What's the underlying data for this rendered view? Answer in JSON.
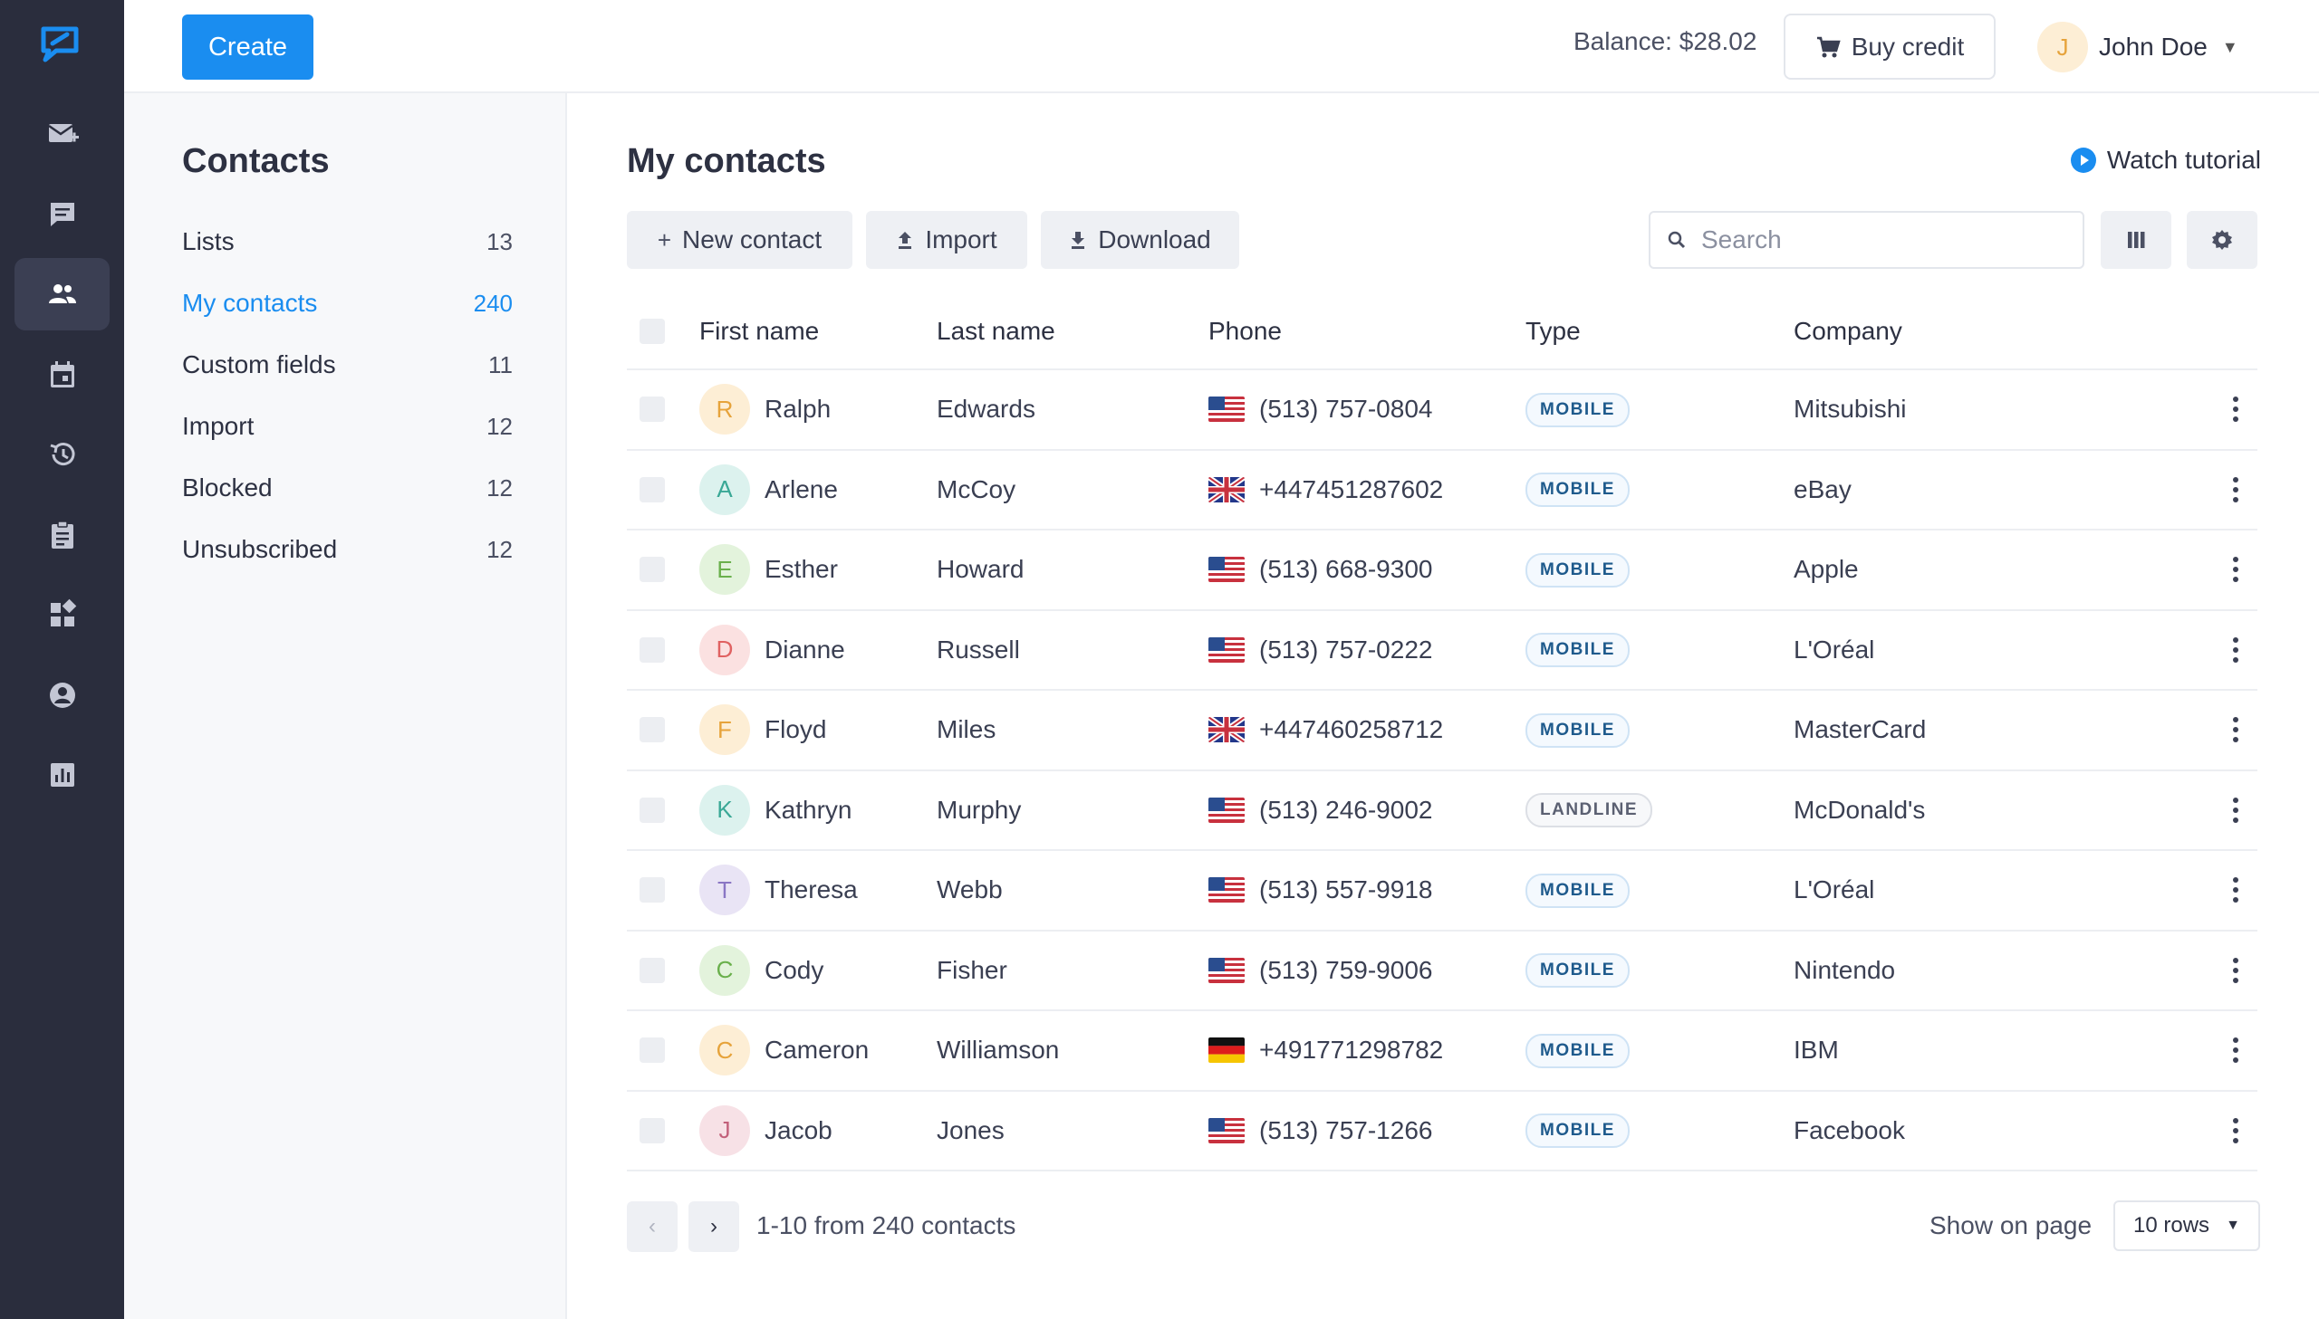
{
  "topbar": {
    "create_label": "Create",
    "balance": "Balance: $28.02",
    "buy_credit_label": "Buy credit",
    "user_initial": "J",
    "user_name": "John Doe"
  },
  "rail": {
    "icons": [
      "compose-icon",
      "chat-icon",
      "contacts-icon",
      "calendar-icon",
      "history-icon",
      "clipboard-icon",
      "apps-icon",
      "account-icon",
      "reports-icon"
    ],
    "active_index": 2
  },
  "sidebar": {
    "title": "Contacts",
    "items": [
      {
        "label": "Lists",
        "count": "13"
      },
      {
        "label": "My contacts",
        "count": "240"
      },
      {
        "label": "Custom fields",
        "count": "11"
      },
      {
        "label": "Import",
        "count": "12"
      },
      {
        "label": "Blocked",
        "count": "12"
      },
      {
        "label": "Unsubscribed",
        "count": "12"
      }
    ]
  },
  "main": {
    "title": "My contacts",
    "watch_tutorial": "Watch tutorial",
    "new_contact_label": "New contact",
    "import_label": "Import",
    "download_label": "Download",
    "search_placeholder": "Search"
  },
  "table": {
    "headers": {
      "first": "First name",
      "last": "Last name",
      "phone": "Phone",
      "type": "Type",
      "company": "Company"
    },
    "rows": [
      {
        "initial": "R",
        "first": "Ralph",
        "last": "Edwards",
        "flag": "us",
        "phone": "(513) 757-0804",
        "type": "MOBILE",
        "company": "Mitsubishi",
        "avatar_bg": "#fdeed5",
        "avatar_fg": "#e6a33b"
      },
      {
        "initial": "A",
        "first": "Arlene",
        "last": "McCoy",
        "flag": "uk",
        "phone": "+447451287602",
        "type": "MOBILE",
        "company": "eBay",
        "avatar_bg": "#dcf2ee",
        "avatar_fg": "#3aa896"
      },
      {
        "initial": "E",
        "first": "Esther",
        "last": "Howard",
        "flag": "us",
        "phone": "(513) 668-9300",
        "type": "MOBILE",
        "company": "Apple",
        "avatar_bg": "#e3f3dc",
        "avatar_fg": "#6ab04c"
      },
      {
        "initial": "D",
        "first": "Dianne",
        "last": "Russell",
        "flag": "us",
        "phone": "(513) 757-0222",
        "type": "MOBILE",
        "company": "L'Oréal",
        "avatar_bg": "#fbe1e1",
        "avatar_fg": "#e06262"
      },
      {
        "initial": "F",
        "first": "Floyd",
        "last": "Miles",
        "flag": "uk",
        "phone": "+447460258712",
        "type": "MOBILE",
        "company": "MasterCard",
        "avatar_bg": "#fdeed5",
        "avatar_fg": "#e6a33b"
      },
      {
        "initial": "K",
        "first": "Kathryn",
        "last": "Murphy",
        "flag": "us",
        "phone": "(513) 246-9002",
        "type": "LANDLINE",
        "company": "McDonald's",
        "avatar_bg": "#dcf2ee",
        "avatar_fg": "#3aa896"
      },
      {
        "initial": "T",
        "first": "Theresa",
        "last": "Webb",
        "flag": "us",
        "phone": "(513) 557-9918",
        "type": "MOBILE",
        "company": "L'Oréal",
        "avatar_bg": "#e9e4f5",
        "avatar_fg": "#8a76c4"
      },
      {
        "initial": "C",
        "first": "Cody",
        "last": "Fisher",
        "flag": "us",
        "phone": "(513) 759-9006",
        "type": "MOBILE",
        "company": "Nintendo",
        "avatar_bg": "#e3f3dc",
        "avatar_fg": "#6ab04c"
      },
      {
        "initial": "C",
        "first": "Cameron",
        "last": "Williamson",
        "flag": "de",
        "phone": "+491771298782",
        "type": "MOBILE",
        "company": "IBM",
        "avatar_bg": "#fdeed5",
        "avatar_fg": "#e6a33b"
      },
      {
        "initial": "J",
        "first": "Jacob",
        "last": "Jones",
        "flag": "us",
        "phone": "(513) 757-1266",
        "type": "MOBILE",
        "company": "Facebook",
        "avatar_bg": "#f7e1e6",
        "avatar_fg": "#c2607a"
      }
    ]
  },
  "footer": {
    "range": "1-10 from 240 contacts",
    "show_on_page": "Show on page",
    "rows_value": "10 rows"
  },
  "colors": {
    "accent": "#1a8df0",
    "rail_bg": "#2a2d3d"
  }
}
